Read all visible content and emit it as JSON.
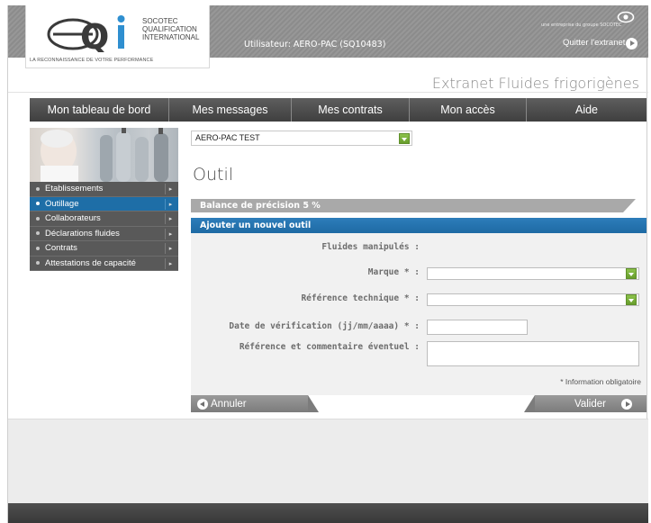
{
  "header": {
    "brand_lines": [
      "SOCOTEC",
      "QUALIFICATION",
      "INTERNATIONAL"
    ],
    "brand_tagline": "LA RECONNAISSANCE DE VOTRE PERFORMANCE",
    "user_label": "Utilisateur: AERO-PAC (SQ10483)",
    "group_text": "une entreprise du groupe SOCOTEC",
    "quit_label": "Quitter l'extranet",
    "site_title": "Extranet Fluides frigorigènes"
  },
  "nav": {
    "items": [
      "Mon tableau de bord",
      "Mes messages",
      "Mes contrats",
      "Mon accès",
      "Aide"
    ]
  },
  "sidebar": {
    "items": [
      {
        "label": "Etablissements",
        "active": false
      },
      {
        "label": "Outillage",
        "active": true
      },
      {
        "label": "Collaborateurs",
        "active": false
      },
      {
        "label": "Déclarations fluides",
        "active": false
      },
      {
        "label": "Contrats",
        "active": false
      },
      {
        "label": "Attestations de capacité",
        "active": false
      }
    ]
  },
  "content": {
    "site_select_value": "AERO-PAC TEST",
    "page_title": "Outil",
    "tool_tab": "Balance de précision 5 %",
    "form_title": "Ajouter un nouvel outil",
    "fields": {
      "fluids_label": "Fluides manipulés :",
      "brand_label": "Marque * :",
      "tech_ref_label": "Référence technique * :",
      "check_date_label": "Date de vérification (jj/mm/aaaa) * :",
      "comment_label": "Référence et commentaire éventuel :"
    },
    "required_note": "* Information obligatoire",
    "cancel_label": "Annuler",
    "validate_label": "Valider"
  },
  "colors": {
    "accent_blue": "#1e6aa4",
    "nav_dark": "#4a4a4a",
    "select_green": "#7ab33d"
  }
}
